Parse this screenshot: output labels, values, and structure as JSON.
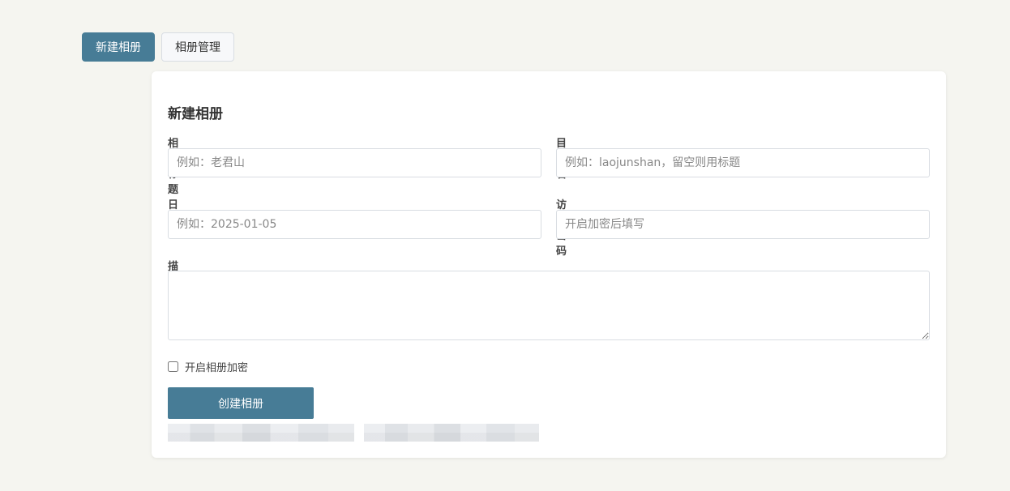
{
  "tabs": [
    {
      "label": "新建相册",
      "active": true
    },
    {
      "label": "相册管理",
      "active": false
    }
  ],
  "form": {
    "title": "新建相册",
    "fields": {
      "album_title": {
        "label": "相册标题",
        "placeholder": "例如：老君山",
        "value": ""
      },
      "directory": {
        "label": "目录名",
        "placeholder": "例如：laojunshan，留空则用标题",
        "value": ""
      },
      "date": {
        "label": "日期",
        "placeholder": "例如：2025-01-05",
        "value": ""
      },
      "password": {
        "label": "访问密码",
        "placeholder": "开启加密后填写",
        "value": ""
      },
      "description": {
        "label": "描述",
        "value": ""
      }
    },
    "encrypt_label": "开启相册加密",
    "encrypt_checked": false,
    "submit_label": "创建相册"
  },
  "colors": {
    "accent": "#477c96",
    "background": "#f5f5f0",
    "card": "#ffffff"
  }
}
